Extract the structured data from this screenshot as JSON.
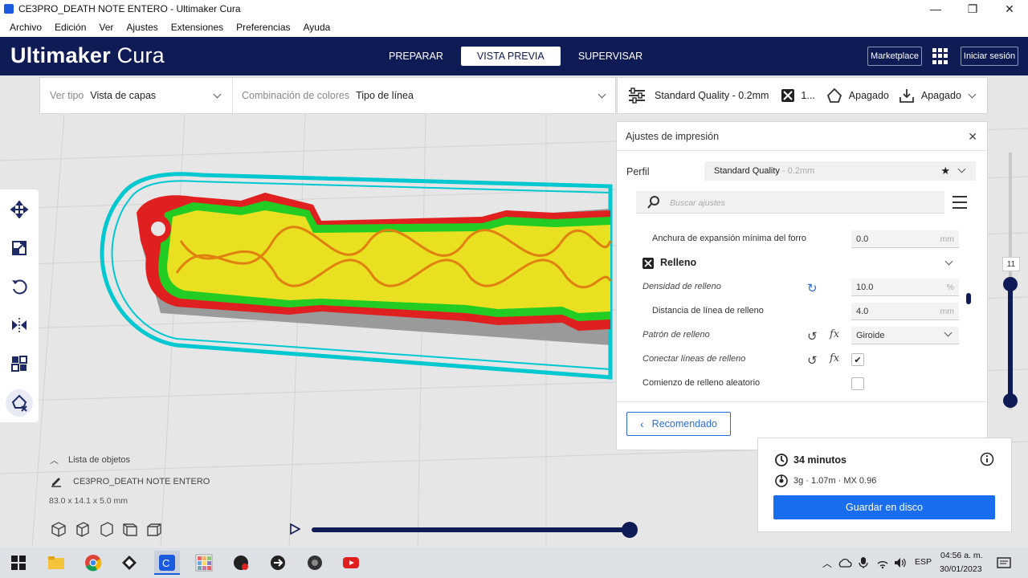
{
  "window": {
    "title": "CE3PRO_DEATH NOTE ENTERO - Ultimaker Cura"
  },
  "menu": [
    "Archivo",
    "Edición",
    "Ver",
    "Ajustes",
    "Extensiones",
    "Preferencias",
    "Ayuda"
  ],
  "header": {
    "brand_bold": "Ultimaker",
    "brand_light": "Cura",
    "stages": [
      "PREPARAR",
      "VISTA PREVIA",
      "SUPERVISAR"
    ],
    "active_stage": "VISTA PREVIA",
    "marketplace": "Marketplace",
    "signin": "Iniciar sesión"
  },
  "viewbar": {
    "view_type_label": "Ver tipo",
    "view_type_value": "Vista de capas",
    "color_scheme_label": "Combinación de colores",
    "color_scheme_value": "Tipo de línea"
  },
  "printbar": {
    "quality": "Standard Quality - 0.2mm",
    "infill": "1...",
    "support": "Apagado",
    "adhesion": "Apagado"
  },
  "panel": {
    "title": "Ajustes de impresión",
    "profile_label": "Perfil",
    "profile_name": "Standard Quality",
    "profile_detail": " - 0.2mm",
    "search_placeholder": "Buscar ajustes",
    "settings": {
      "skin_expand": {
        "label": "Anchura de expansión mínima del forro",
        "value": "0.0",
        "unit": "mm"
      },
      "category": "Relleno",
      "infill_density": {
        "label": "Densidad de relleno",
        "value": "10.0",
        "unit": "%"
      },
      "line_distance": {
        "label": "Distancia de línea de relleno",
        "value": "4.0",
        "unit": "mm"
      },
      "infill_pattern": {
        "label": "Patrón de relleno",
        "value": "Giroide"
      },
      "connect_lines": {
        "label": "Conectar líneas de relleno",
        "checked": "✔"
      },
      "random_start": {
        "label": "Comienzo de relleno aleatorio"
      }
    },
    "recommended_button": "Recomendado"
  },
  "layer_slider": {
    "current": "11"
  },
  "objects": {
    "title": "Lista de objetos",
    "name": "CE3PRO_DEATH NOTE ENTERO",
    "dims": "83.0 x 14.1 x 5.0 mm"
  },
  "estimate": {
    "time": "34 minutos",
    "material": "3g · 1.07m · MX 0.96",
    "save_button": "Guardar en disco"
  },
  "taskbar": {
    "lang": "ESP",
    "time": "04:56 a. m.",
    "date": "30/01/2023"
  },
  "colors": {
    "header": "#0f1b55",
    "accent": "#196ef0",
    "shell": "#00c8d0",
    "wall_outer": "#e02020",
    "wall_inner": "#22cc22",
    "infill": "#e8e020"
  }
}
